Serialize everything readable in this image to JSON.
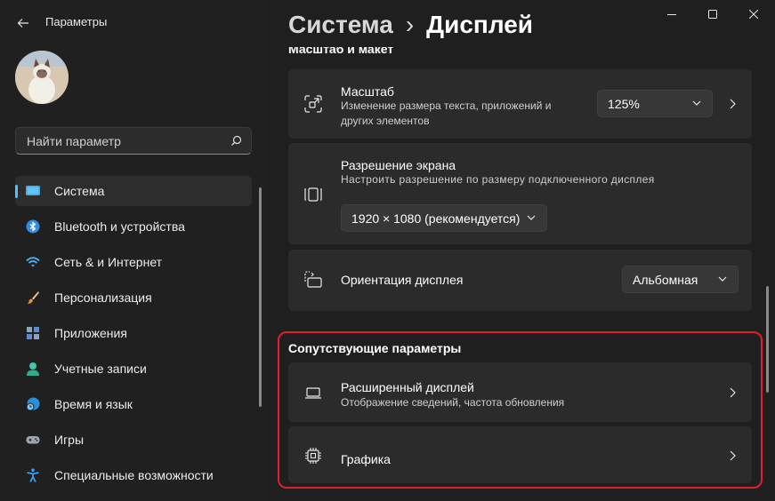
{
  "app": {
    "title": "Параметры"
  },
  "search": {
    "placeholder": "Найти параметр"
  },
  "nav": [
    {
      "label": "Система",
      "icon": "system-icon",
      "selected": true
    },
    {
      "label": "Bluetooth и устройства",
      "icon": "bluetooth-icon"
    },
    {
      "label": "Сеть & и Интернет",
      "icon": "wifi-icon"
    },
    {
      "label": "Персонализация",
      "icon": "brush-icon"
    },
    {
      "label": "Приложения",
      "icon": "apps-icon"
    },
    {
      "label": "Учетные записи",
      "icon": "account-icon"
    },
    {
      "label": "Время и язык",
      "icon": "globe-clock-icon"
    },
    {
      "label": "Игры",
      "icon": "gamepad-icon"
    },
    {
      "label": "Специальные возможности",
      "icon": "accessibility-icon"
    }
  ],
  "header": {
    "parent": "Система",
    "separator": "›",
    "current": "Дисплей"
  },
  "section_top": "Масштаб и макет",
  "scale": {
    "title": "Масштаб",
    "desc": "Изменение размера текста, приложений и других элементов",
    "value": "125%"
  },
  "resolution": {
    "title": "Разрешение экрана",
    "desc": "Настроить разрешение по размеру подключенного дисплея",
    "value": "1920 × 1080 (рекомендуется)"
  },
  "orientation": {
    "title": "Ориентация дисплея",
    "value": "Альбомная"
  },
  "related": {
    "heading": "Сопутствующие параметры",
    "advanced": {
      "title": "Расширенный дисплей",
      "desc": "Отображение сведений, частота обновления"
    },
    "graphics": {
      "title": "Графика"
    }
  },
  "colors": {
    "accent": "#4cc2ff",
    "highlight": "#e01e2c",
    "card": "#2b2b2b"
  }
}
